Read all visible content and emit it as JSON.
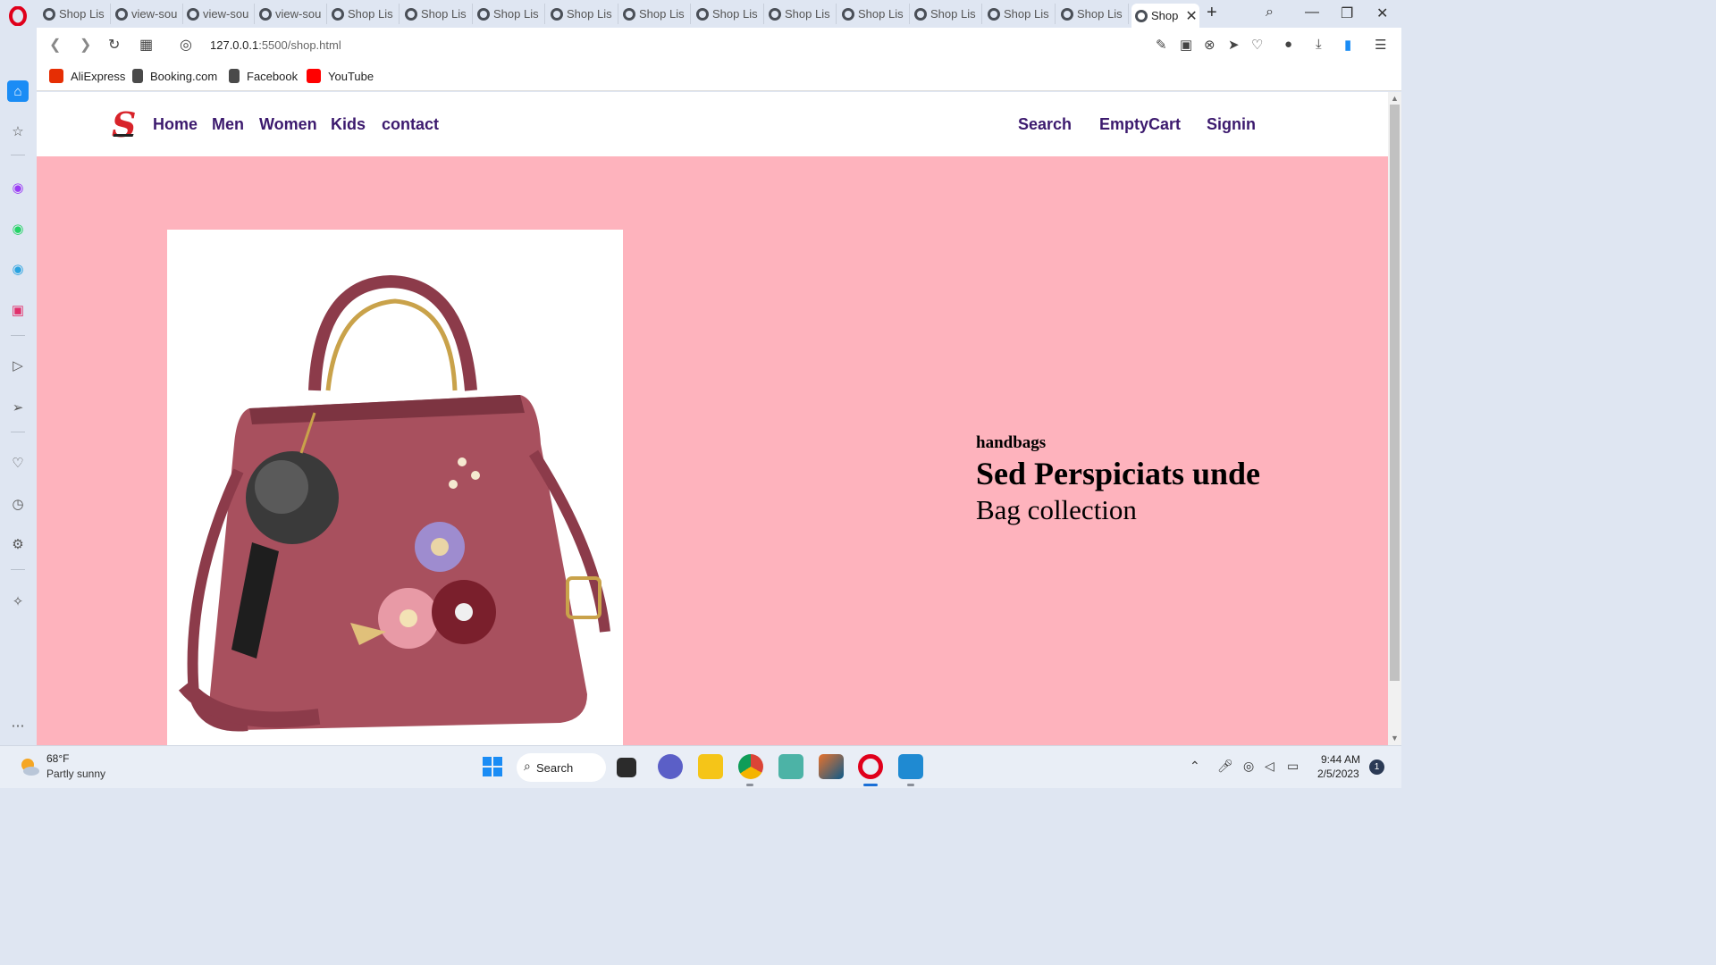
{
  "browser": {
    "tabs": [
      {
        "title": "Shop Lis"
      },
      {
        "title": "view-sou"
      },
      {
        "title": "view-sou"
      },
      {
        "title": "view-sou"
      },
      {
        "title": "Shop Lis"
      },
      {
        "title": "Shop Lis"
      },
      {
        "title": "Shop Lis"
      },
      {
        "title": "Shop Lis"
      },
      {
        "title": "Shop Lis"
      },
      {
        "title": "Shop Lis"
      },
      {
        "title": "Shop Lis"
      },
      {
        "title": "Shop Lis"
      },
      {
        "title": "Shop Lis"
      },
      {
        "title": "Shop Lis"
      },
      {
        "title": "Shop Lis"
      },
      {
        "title": "Shop"
      }
    ],
    "url_host": "127.0.0.1",
    "url_path": ":5500/shop.html",
    "bookmarks": [
      {
        "label": "AliExpress",
        "color": "#e62e04"
      },
      {
        "label": "Booking.com",
        "color": "#4a4a4a"
      },
      {
        "label": "Facebook",
        "color": "#4a4a4a"
      },
      {
        "label": "YouTube",
        "color": "#ff0000"
      }
    ]
  },
  "site": {
    "logo": "S",
    "nav_left": [
      "Home",
      "Men",
      "Women",
      "Kids",
      "contact"
    ],
    "nav_right": [
      "Search",
      "EmptyCart",
      "Signin"
    ],
    "hero": {
      "category": "handbags",
      "title": "Sed Perspiciats unde",
      "subtitle": "Bag collection"
    },
    "colors": {
      "hero_bg": "#feb3bd",
      "nav_text": "#3c1a6e",
      "logo": "#d8232a"
    }
  },
  "taskbar": {
    "temp": "68°F",
    "weather": "Partly sunny",
    "search": "Search",
    "time": "9:44 AM",
    "date": "2/5/2023",
    "notifications": "1"
  }
}
